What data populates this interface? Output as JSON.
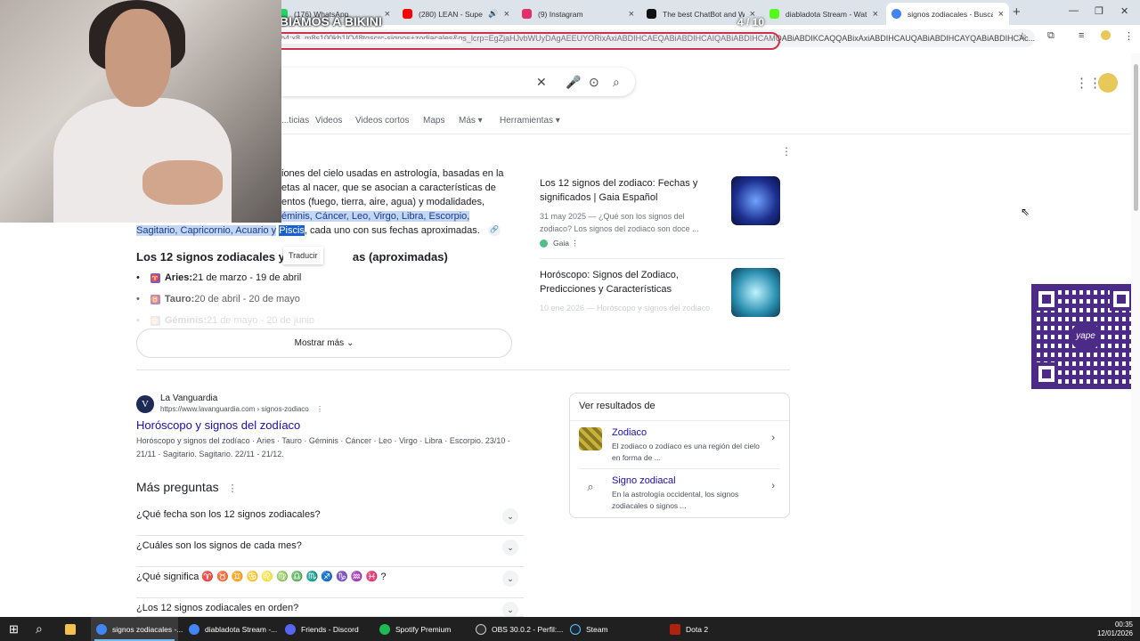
{
  "browser": {
    "tabs": [
      {
        "label": "(176) WhatsApp",
        "color": "#25d366",
        "active": false
      },
      {
        "label": "(280) LEAN - Superio",
        "color": "#ff0000",
        "active": false,
        "sound": true
      },
      {
        "label": "(9) Instagram",
        "color": "#e1306c",
        "active": false
      },
      {
        "label": "The best ChatBot and W",
        "color": "#111111",
        "active": false
      },
      {
        "label": "diabladota Stream - Wat",
        "color": "#53fc18",
        "active": false
      },
      {
        "label": "signos zodiacales - Busca",
        "color": "#4285f4",
        "active": true
      }
    ],
    "new_tab": "+",
    "url": "ix8_m8s100kb1lQ48tqscrc-signos+zodiacales&gs_lcrp=EgZjaHJvbWUyDAgAEEUYOR...",
    "url_tail": "rb4;x8_m8s100kb1lQ48tqscrc-signos+zodiacales&gs_lcrp=EgZjaHJvbWUyDAgAEEUYORixAxiABDIHCAEQABiABDIHCAIQABiABDIHCAMQABiABDIKCAQQABixAxiABDIHCAUQABiABDIHCAYQABiABDIHCAc..."
  },
  "overlay": {
    "title": "CAMBIAMOS A BIKINI",
    "count": "4 / 10",
    "progress": 0.4
  },
  "search": {
    "close_icon": "✕",
    "filters": [
      "...ticias",
      "Videos",
      "Videos cortos",
      "Maps",
      "Más ▾",
      "Herramientas ▾"
    ]
  },
  "summary": {
    "line1": "iones del cielo usadas en astrología, basadas en la",
    "line2": "etas al nacer, que se asocian a características de",
    "line3": "entos (fuego, tierra, aire, agua) y modalidades,",
    "hl_signs": "éminis, Cáncer, Leo, Virgo, Libra, Escorpio,",
    "hl_signs2": "Sagitario, Capricornio, Acuario y",
    "hl_piscis": "Piscis",
    "tail": ", cada uno con sus fechas aproximadas.",
    "tooltip": "Traducir",
    "subhead": "Los 12 signos zodiacales y",
    "subhead_end": "as (aproximadas)",
    "signs": [
      {
        "symbol": "♈",
        "name": "Aries:",
        "dates": " 21 de marzo - 19 de abril"
      },
      {
        "symbol": "♉",
        "name": "Tauro:",
        "dates": " 20 de abril - 20 de mayo"
      },
      {
        "symbol": "♊",
        "name": "Géminis:",
        "dates": " 21 de mayo - 20 de junio"
      }
    ],
    "more_button": "Mostrar más"
  },
  "side_cards": [
    {
      "title": "Los 12 signos del zodiaco: Fechas y significados | Gaia Español",
      "meta": "31 may 2025 — ¿Qué son los signos del zodiaco? Los signos del zodiaco son doce ...",
      "source": "Gaia",
      "thumb_color": "#1d2f8f"
    },
    {
      "title": "Horóscopo: Signos del Zodiaco, Predicciones y Características",
      "meta": "10 ene 2026 — Horóscopo y signos del zodiaco son ...",
      "source": "",
      "thumb_color": "#2a8fb0"
    }
  ],
  "result": {
    "site_letter": "V",
    "site_name": "La Vanguardia",
    "url": "https://www.lavanguardia.com › signos-zodiaco",
    "title": "Horóscopo y signos del zodíaco",
    "snippet": "Horóscopo y signos del zodíaco · Aries · Tauro · Géminis · Cáncer · Leo · Virgo · Libra · Escorpio. 23/10 - 21/11 · Sagitario. Sagitario. 22/11 - 21/12."
  },
  "paa": {
    "title": "Más preguntas",
    "questions": [
      "¿Qué fecha son los 12 signos zodiacales?",
      "¿Cuáles son los signos de cada mes?",
      "¿Qué significa ♈ ♉ ♊ ♋ ♌ ♍ ♎ ♏ ♐ ♑ ♒ ♓ ?",
      "¿Los 12 signos zodiacales en orden?"
    ]
  },
  "ver_resultados": {
    "title": "Ver resultados de",
    "items": [
      {
        "title": "Zodiaco",
        "desc": "El zodiaco o zodíaco es una región del cielo en forma de ...",
        "icon_color": "#c9b23a"
      },
      {
        "title": "Signo zodiacal",
        "desc": "En la astrología occidental, los signos zodiacales o signos ...",
        "icon_color": "#ffffff"
      }
    ]
  },
  "qr": {
    "logo_text": "yape",
    "color": "#4b2b87"
  },
  "taskbar": {
    "items": [
      {
        "label": "signos zodiacales -...",
        "color": "#4285f4",
        "active": true
      },
      {
        "label": "diabladota Stream -...",
        "color": "#4285f4",
        "active": false
      },
      {
        "label": "Friends - Discord",
        "color": "#5865f2",
        "active": false
      },
      {
        "label": "Spotify Premium",
        "color": "#1db954",
        "active": false
      },
      {
        "label": "OBS 30.0.2 - Perfil:...",
        "color": "#302e31",
        "active": false
      },
      {
        "label": "Steam",
        "color": "#1b2838",
        "active": false
      },
      {
        "label": "Dota 2",
        "color": "#b1210f",
        "active": false
      }
    ],
    "time": "00:35",
    "date": "12/01/2026"
  }
}
